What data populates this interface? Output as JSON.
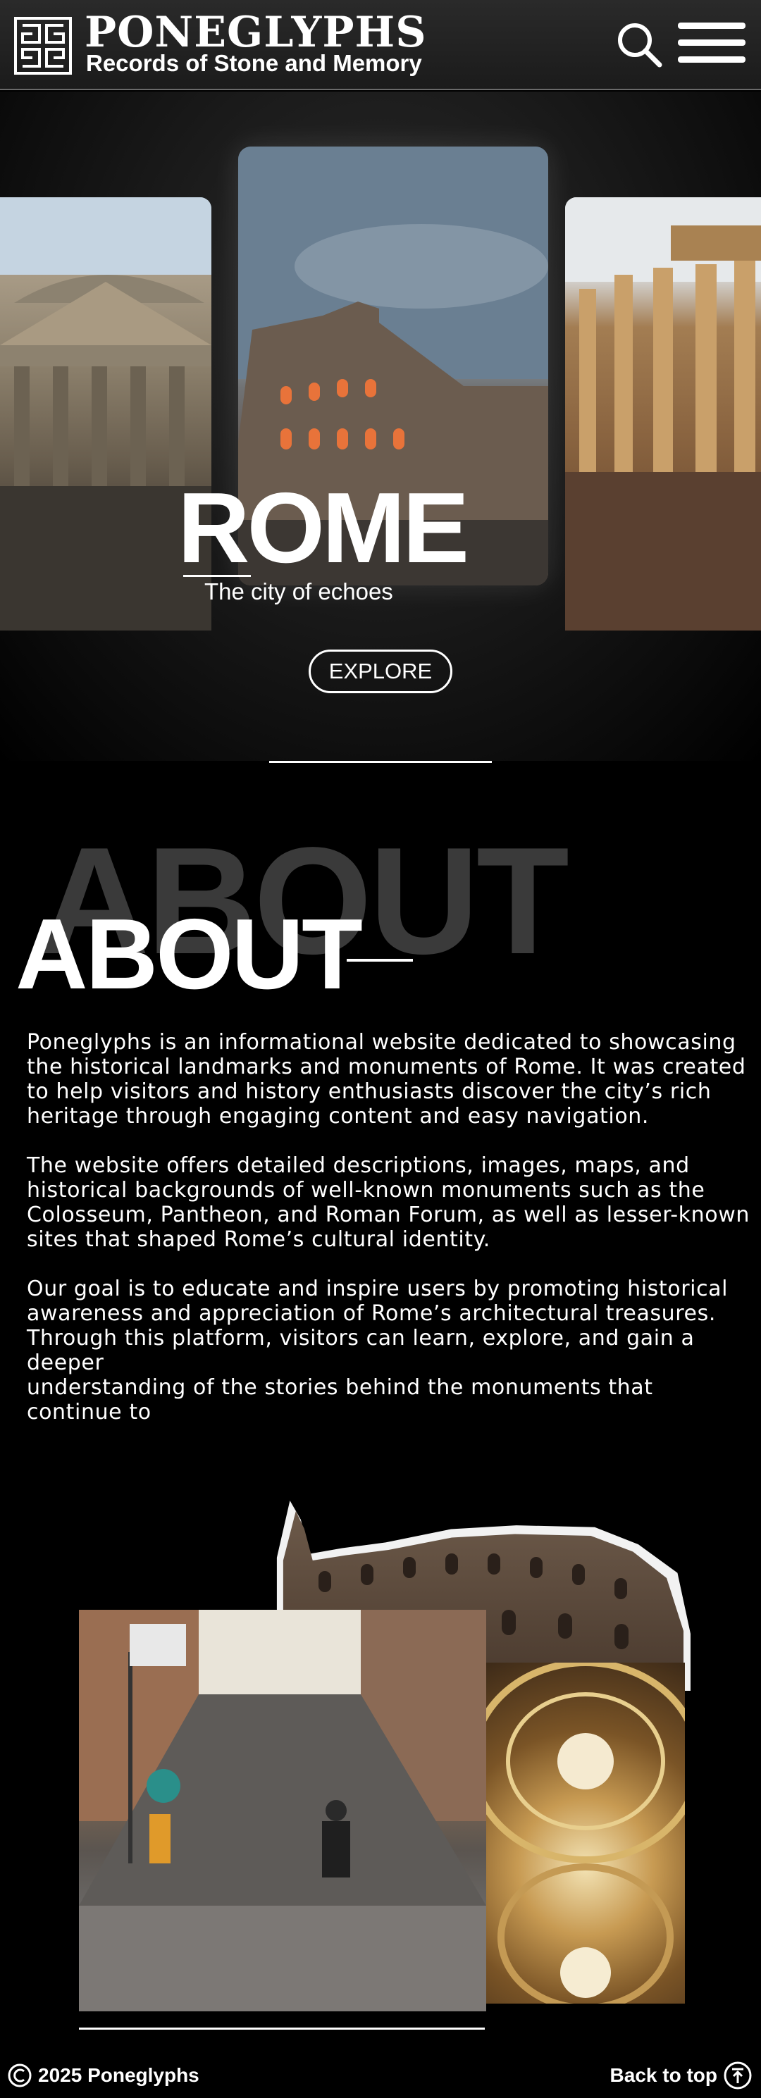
{
  "header": {
    "brand_title": "PONEGLYPHS",
    "brand_subtitle": "Records of Stone and Memory",
    "search_icon": "search-icon",
    "menu_icon": "hamburger-menu-icon"
  },
  "hero": {
    "cards": [
      "Pantheon",
      "Colosseum",
      "Temple of Antoninus and Faustina"
    ],
    "city": "ROME",
    "tagline": "The city of echoes",
    "explore_label": "EXPLORE"
  },
  "about": {
    "ghost_title": "ABOUT",
    "title": "ABOUT",
    "paragraphs": [
      "Poneglyphs is an informational website dedicated to showcasing\nthe historical landmarks and monuments of Rome. It was created\nto help visitors and history enthusiasts discover the city’s rich\nheritage through engaging content and easy navigation.",
      "The website offers detailed descriptions, images, maps, and\nhistorical backgrounds of well-known monuments such as the\nColosseum, Pantheon, and Roman Forum, as well as lesser-known\nsites that shaped Rome’s cultural identity.",
      "Our goal is to educate and inspire users by promoting historical\nawareness and appreciation of Rome’s architectural treasures.\nThrough this platform, visitors can learn, explore, and gain a deeper\nunderstanding of the stories behind the monuments that continue to"
    ]
  },
  "collage": {
    "images": [
      "Colosseum cutout",
      "Rome street with scooter",
      "Dome interior"
    ]
  },
  "footer": {
    "copyright": "2025 Poneglyphs",
    "back_to_top": "Back to top"
  },
  "colors": {
    "background": "#000000",
    "header": "#222222",
    "text": "#ffffff",
    "ghost_text": "#3a3a3a"
  }
}
